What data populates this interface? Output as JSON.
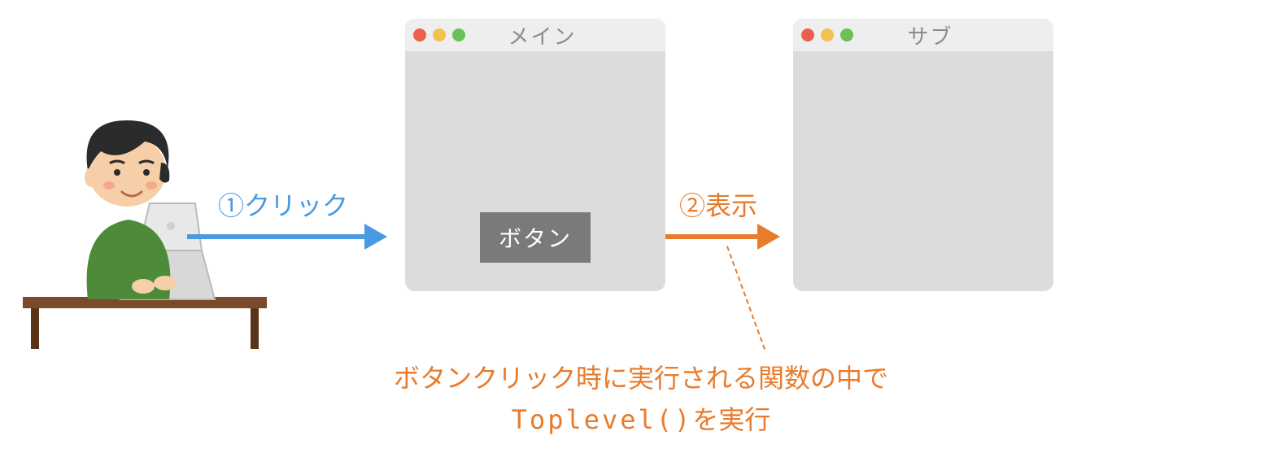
{
  "main_window": {
    "title": "メイン",
    "button_label": "ボタン"
  },
  "sub_window": {
    "title": "サブ"
  },
  "step1": {
    "label": "①クリック"
  },
  "step2": {
    "label": "②表示"
  },
  "caption": {
    "line1": "ボタンクリック時に実行される関数の中で",
    "line2_pre": "Toplevel()",
    "line2_post": "を実行"
  },
  "colors": {
    "blue": "#4a9ae1",
    "orange": "#e87b2c",
    "window_bg": "#dcdcdc",
    "titlebar_bg": "#eeeeee",
    "button_bg": "#7a7a7a"
  }
}
